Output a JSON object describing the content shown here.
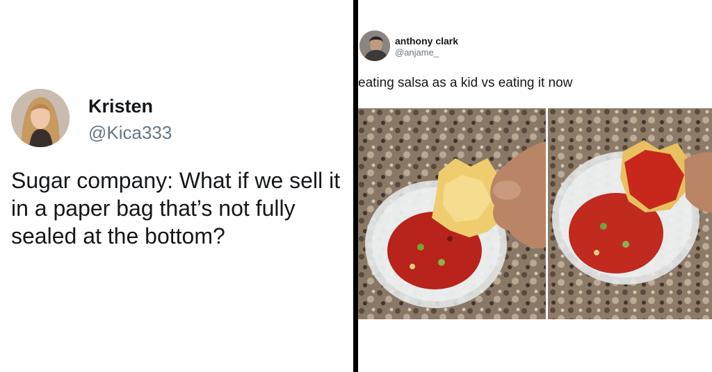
{
  "left_tweet": {
    "name": "Kristen",
    "handle": "@Kica333",
    "text": "Sugar company: What if we sell it in a paper bag that’s not fully sealed at the bottom?"
  },
  "right_tweet": {
    "name": "anthony clark",
    "handle": "@anjame_",
    "text": "eating salsa as a kid vs eating it now"
  },
  "colors": {
    "divider": "#000000",
    "text_primary": "#14171a",
    "text_secondary": "#657786"
  }
}
